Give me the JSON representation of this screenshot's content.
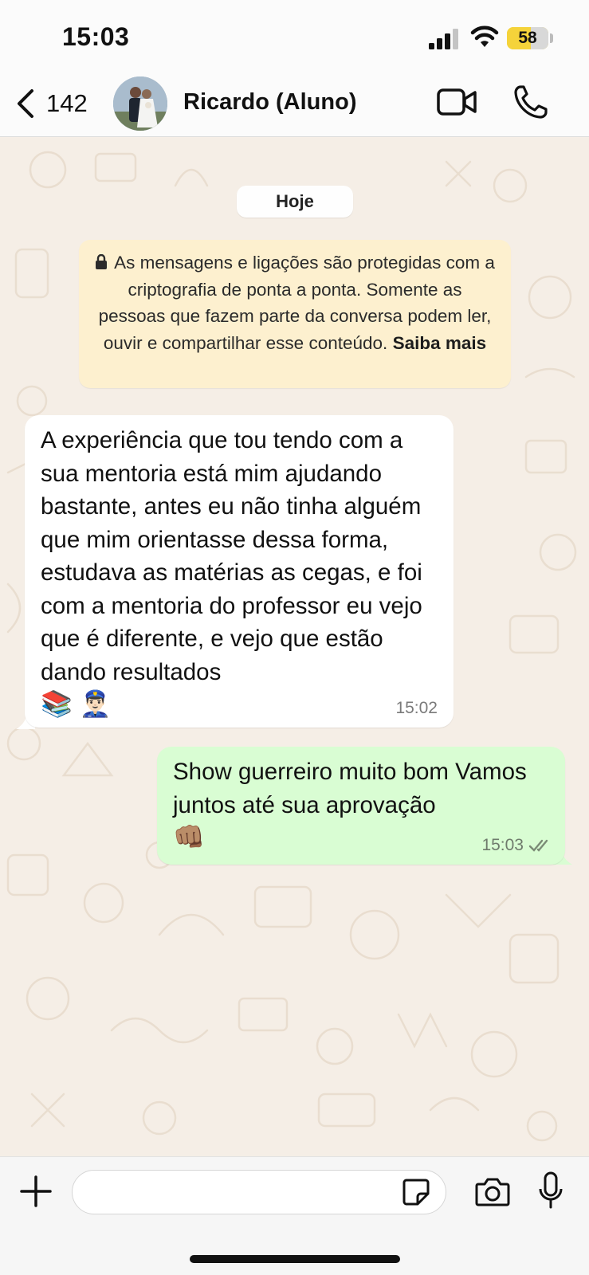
{
  "status_bar": {
    "time": "15:03",
    "battery_level": "58",
    "battery_fraction": 0.58,
    "icons": [
      "signal-icon",
      "wifi-icon",
      "battery-icon"
    ]
  },
  "header": {
    "back_count": "142",
    "contact_name": "Ricardo (Aluno)",
    "icons": [
      "chevron-left-icon",
      "video-call-icon",
      "phone-icon"
    ]
  },
  "chat": {
    "date_label": "Hoje",
    "e2e_notice": {
      "text": "As mensagens e ligações são protegidas com a criptografia de ponta a ponta. Somente as pessoas que fazem parte da conversa podem ler, ouvir e compartilhar esse conteúdo.",
      "link": "Saiba mais"
    },
    "messages": [
      {
        "direction": "incoming",
        "text": "A  experiência que tou tendo com a sua mentoria está mim ajudando bastante, antes eu não tinha alguém que mim orientasse dessa forma, estudava as matérias as cegas, e foi com a mentoria do professor eu vejo que é diferente, e vejo que estão dando resultados",
        "emoji": "📚 👮🏻‍♂️",
        "time": "15:02"
      },
      {
        "direction": "outgoing",
        "text": "Show guerreiro muito bom Vamos juntos até sua aprovação",
        "emoji": "👊🏽",
        "time": "15:03",
        "status": "read"
      }
    ]
  },
  "composer": {
    "input_value": "",
    "icons": [
      "plus-icon",
      "sticker-icon",
      "camera-icon",
      "microphone-icon"
    ]
  },
  "colors": {
    "wallpaper": "#f5eee6",
    "incoming_bubble": "#ffffff",
    "outgoing_bubble": "#d9fdd3",
    "notice_bubble": "#fdf0cf",
    "battery": "#f5d33a"
  }
}
